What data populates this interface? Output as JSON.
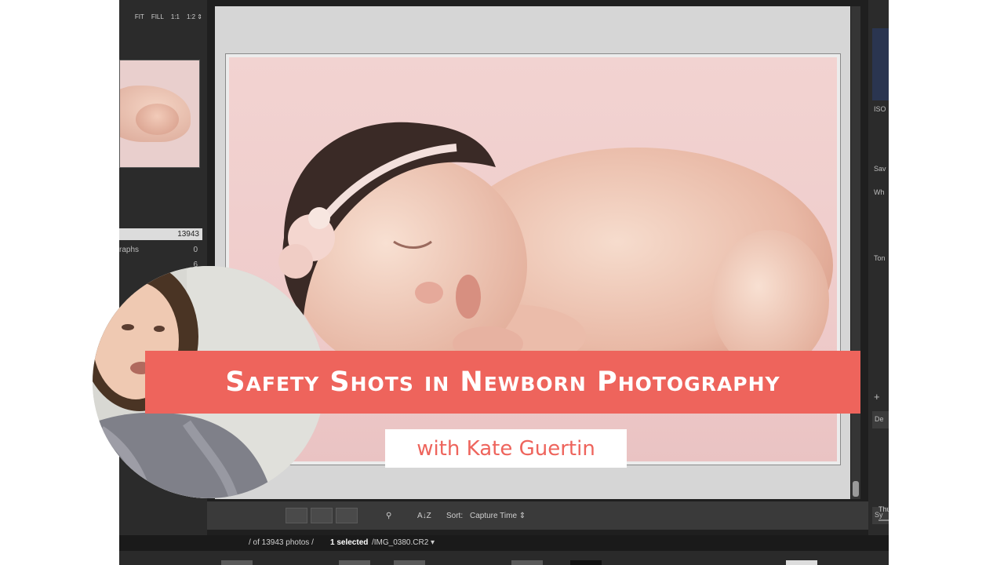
{
  "zoom_options": [
    "FIT",
    "FILL",
    "1:1",
    "1:2 ⇕"
  ],
  "catalog": {
    "total_count": "13943",
    "rows": [
      {
        "label": "raphs",
        "count": "0"
      },
      {
        "label": "",
        "count": "6"
      }
    ]
  },
  "right_panel": {
    "iso_label": "ISO",
    "save_label": "Sav",
    "wb_label": "Wh",
    "tone_label": "Ton",
    "plus_label": "+",
    "def_label": "De",
    "sync_label": "Sy"
  },
  "toolbar": {
    "sort_label": "Sort:",
    "sort_value": "Capture Time ⇕",
    "thumbnails_label": "Thumbnails",
    "az_icon_text": "A↓Z"
  },
  "status": {
    "text_prefix": "/ of 13943 photos /",
    "selected_text": "1 selected",
    "filename": "/IMG_0380.CR2 ▾"
  },
  "overlay": {
    "title": "Safety Shots in Newborn Photography",
    "subtitle": "with Kate Guertin"
  },
  "colors": {
    "accent": "#ee645c",
    "backdrop": "#efcccb",
    "panel_dark": "#2b2b2b"
  }
}
